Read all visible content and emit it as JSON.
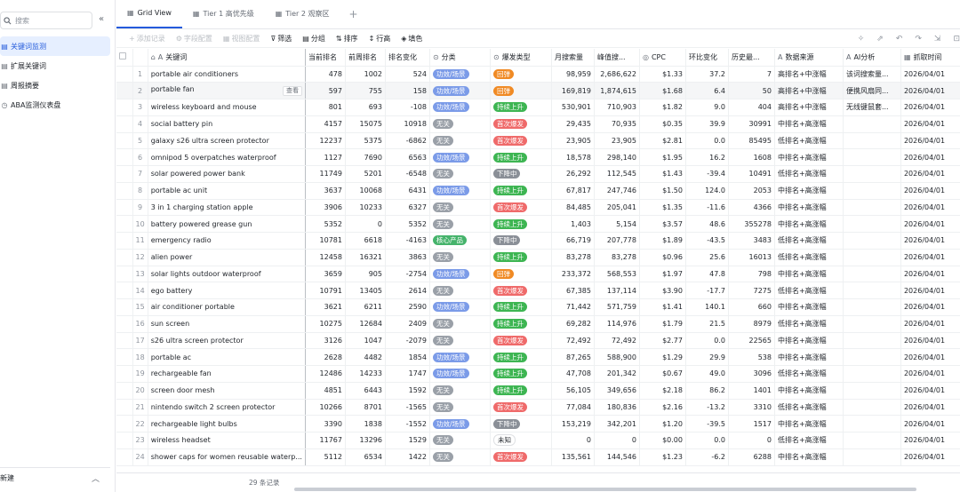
{
  "sidebar": {
    "search_placeholder": "搜索",
    "items": [
      {
        "label": "关键词监测",
        "active": true
      },
      {
        "label": "扩展关键词",
        "active": false
      },
      {
        "label": "周报摘要",
        "active": false
      },
      {
        "label": "ABA监测仪表盘",
        "active": false
      }
    ],
    "bottom_label": "新建"
  },
  "tabs": [
    {
      "label": "Grid View",
      "active": true
    },
    {
      "label": "Tier 1 高优先级",
      "active": false
    },
    {
      "label": "Tier 2 观察区",
      "active": false
    }
  ],
  "toolbar": {
    "add_record": "添加记录",
    "field_config": "字段配置",
    "view_config": "视图配置",
    "filter": "筛选",
    "group": "分组",
    "sort": "排序",
    "row_height": "行高",
    "fill": "填色"
  },
  "columns": [
    "关键词",
    "当前排名",
    "前周排名",
    "排名变化",
    "分类",
    "爆发类型",
    "月搜索量",
    "峰值搜...",
    "CPC",
    "环比变化",
    "历史最...",
    "数据来源",
    "AI分析",
    "抓取时间"
  ],
  "view_button": "查看",
  "record_count": "29 条记录",
  "tag_colors": {
    "功效/场景": "#7b9be8",
    "无关": "#9aa0a8",
    "核心产品": "#45b36b",
    "回弹": "#f08a24",
    "持续上升": "#3db552",
    "首次爆发": "#ef6a6a",
    "下降中": "#8a8f97",
    "未知": "#ffffff"
  },
  "rows": [
    {
      "idx": "1",
      "kw": "portable air conditioners",
      "cur": "478",
      "prev": "1002",
      "chg": "524",
      "cat": "功效/场景",
      "type": "回弹",
      "vol": "98,959",
      "peak": "2,686,622",
      "cpc": "$1.33",
      "mom": "37.2",
      "hist": "7",
      "src": "高排名+中涨幅",
      "ai": "该词搜索量...",
      "time": "2026/04/01"
    },
    {
      "idx": "2",
      "kw": "portable fan",
      "cur": "597",
      "prev": "755",
      "chg": "158",
      "cat": "功效/场景",
      "type": "回弹",
      "vol": "169,819",
      "peak": "1,874,615",
      "cpc": "$1.68",
      "mom": "6.4",
      "hist": "50",
      "src": "高排名+中涨幅",
      "ai": "便携风扇同...",
      "time": "2026/04/01"
    },
    {
      "idx": "3",
      "kw": "wireless keyboard and mouse",
      "cur": "801",
      "prev": "693",
      "chg": "-108",
      "cat": "功效/场景",
      "type": "持续上升",
      "vol": "530,901",
      "peak": "710,903",
      "cpc": "$1.82",
      "mom": "9.0",
      "hist": "404",
      "src": "高排名+中涨幅",
      "ai": "无线键鼠套...",
      "time": "2026/04/01"
    },
    {
      "idx": "4",
      "kw": "social battery pin",
      "cur": "4157",
      "prev": "15075",
      "chg": "10918",
      "cat": "无关",
      "type": "首次爆发",
      "vol": "29,435",
      "peak": "70,935",
      "cpc": "$0.35",
      "mom": "39.9",
      "hist": "30991",
      "src": "中排名+高涨幅",
      "ai": "",
      "time": "2026/04/01"
    },
    {
      "idx": "5",
      "kw": "galaxy s26 ultra screen protector",
      "cur": "12237",
      "prev": "5375",
      "chg": "-6862",
      "cat": "无关",
      "type": "首次爆发",
      "vol": "23,905",
      "peak": "23,905",
      "cpc": "$2.81",
      "mom": "0.0",
      "hist": "85495",
      "src": "低排名+高涨幅",
      "ai": "",
      "time": "2026/04/01"
    },
    {
      "idx": "6",
      "kw": "omnipod 5 overpatches waterproof",
      "cur": "1127",
      "prev": "7690",
      "chg": "6563",
      "cat": "功效/场景",
      "type": "持续上升",
      "vol": "18,578",
      "peak": "298,140",
      "cpc": "$1.95",
      "mom": "16.2",
      "hist": "1608",
      "src": "中排名+高涨幅",
      "ai": "",
      "time": "2026/04/01"
    },
    {
      "idx": "7",
      "kw": "solar powered power bank",
      "cur": "11749",
      "prev": "5201",
      "chg": "-6548",
      "cat": "无关",
      "type": "下降中",
      "vol": "26,292",
      "peak": "112,545",
      "cpc": "$1.43",
      "mom": "-39.4",
      "hist": "10491",
      "src": "低排名+高涨幅",
      "ai": "",
      "time": "2026/04/01"
    },
    {
      "idx": "8",
      "kw": "portable ac unit",
      "cur": "3637",
      "prev": "10068",
      "chg": "6431",
      "cat": "功效/场景",
      "type": "持续上升",
      "vol": "67,817",
      "peak": "247,746",
      "cpc": "$1.50",
      "mom": "124.0",
      "hist": "2053",
      "src": "中排名+高涨幅",
      "ai": "",
      "time": "2026/04/01"
    },
    {
      "idx": "9",
      "kw": "3 in 1 charging station apple",
      "cur": "3906",
      "prev": "10233",
      "chg": "6327",
      "cat": "无关",
      "type": "首次爆发",
      "vol": "84,485",
      "peak": "205,041",
      "cpc": "$1.35",
      "mom": "-11.6",
      "hist": "4366",
      "src": "中排名+高涨幅",
      "ai": "",
      "time": "2026/04/01"
    },
    {
      "idx": "10",
      "kw": "battery powered grease gun",
      "cur": "5352",
      "prev": "0",
      "chg": "5352",
      "cat": "无关",
      "type": "持续上升",
      "vol": "1,403",
      "peak": "5,154",
      "cpc": "$3.57",
      "mom": "48.6",
      "hist": "355278",
      "src": "中排名+高涨幅",
      "ai": "",
      "time": "2026/04/01"
    },
    {
      "idx": "11",
      "kw": "emergency radio",
      "cur": "10781",
      "prev": "6618",
      "chg": "-4163",
      "cat": "核心产品",
      "type": "下降中",
      "vol": "66,719",
      "peak": "207,778",
      "cpc": "$1.89",
      "mom": "-43.5",
      "hist": "3483",
      "src": "低排名+高涨幅",
      "ai": "",
      "time": "2026/04/01"
    },
    {
      "idx": "12",
      "kw": "alien power",
      "cur": "12458",
      "prev": "16321",
      "chg": "3863",
      "cat": "无关",
      "type": "持续上升",
      "vol": "83,278",
      "peak": "83,278",
      "cpc": "$0.96",
      "mom": "25.6",
      "hist": "16013",
      "src": "低排名+高涨幅",
      "ai": "",
      "time": "2026/04/01"
    },
    {
      "idx": "13",
      "kw": "solar lights outdoor waterproof",
      "cur": "3659",
      "prev": "905",
      "chg": "-2754",
      "cat": "功效/场景",
      "type": "回弹",
      "vol": "233,372",
      "peak": "568,553",
      "cpc": "$1.97",
      "mom": "47.8",
      "hist": "798",
      "src": "中排名+高涨幅",
      "ai": "",
      "time": "2026/04/01"
    },
    {
      "idx": "14",
      "kw": "ego battery",
      "cur": "10791",
      "prev": "13405",
      "chg": "2614",
      "cat": "无关",
      "type": "首次爆发",
      "vol": "67,385",
      "peak": "137,114",
      "cpc": "$3.90",
      "mom": "-17.7",
      "hist": "7275",
      "src": "低排名+高涨幅",
      "ai": "",
      "time": "2026/04/01"
    },
    {
      "idx": "15",
      "kw": "air conditioner portable",
      "cur": "3621",
      "prev": "6211",
      "chg": "2590",
      "cat": "功效/场景",
      "type": "持续上升",
      "vol": "71,442",
      "peak": "571,759",
      "cpc": "$1.41",
      "mom": "140.1",
      "hist": "660",
      "src": "中排名+高涨幅",
      "ai": "",
      "time": "2026/04/01"
    },
    {
      "idx": "16",
      "kw": "sun screen",
      "cur": "10275",
      "prev": "12684",
      "chg": "2409",
      "cat": "无关",
      "type": "持续上升",
      "vol": "69,282",
      "peak": "114,976",
      "cpc": "$1.79",
      "mom": "21.5",
      "hist": "8979",
      "src": "低排名+高涨幅",
      "ai": "",
      "time": "2026/04/01"
    },
    {
      "idx": "17",
      "kw": "s26 ultra screen protector",
      "cur": "3126",
      "prev": "1047",
      "chg": "-2079",
      "cat": "无关",
      "type": "首次爆发",
      "vol": "72,492",
      "peak": "72,492",
      "cpc": "$2.77",
      "mom": "0.0",
      "hist": "22565",
      "src": "中排名+高涨幅",
      "ai": "",
      "time": "2026/04/01"
    },
    {
      "idx": "18",
      "kw": "portable ac",
      "cur": "2628",
      "prev": "4482",
      "chg": "1854",
      "cat": "功效/场景",
      "type": "持续上升",
      "vol": "87,265",
      "peak": "588,900",
      "cpc": "$1.29",
      "mom": "29.9",
      "hist": "538",
      "src": "中排名+高涨幅",
      "ai": "",
      "time": "2026/04/01"
    },
    {
      "idx": "19",
      "kw": "rechargeable fan",
      "cur": "12486",
      "prev": "14233",
      "chg": "1747",
      "cat": "功效/场景",
      "type": "持续上升",
      "vol": "47,708",
      "peak": "201,342",
      "cpc": "$0.67",
      "mom": "49.0",
      "hist": "3096",
      "src": "低排名+高涨幅",
      "ai": "",
      "time": "2026/04/01"
    },
    {
      "idx": "20",
      "kw": "screen door mesh",
      "cur": "4851",
      "prev": "6443",
      "chg": "1592",
      "cat": "无关",
      "type": "持续上升",
      "vol": "56,105",
      "peak": "349,656",
      "cpc": "$2.18",
      "mom": "86.2",
      "hist": "1401",
      "src": "中排名+高涨幅",
      "ai": "",
      "time": "2026/04/01"
    },
    {
      "idx": "21",
      "kw": "nintendo switch 2 screen protector",
      "cur": "10266",
      "prev": "8701",
      "chg": "-1565",
      "cat": "无关",
      "type": "首次爆发",
      "vol": "77,084",
      "peak": "180,836",
      "cpc": "$2.16",
      "mom": "-13.2",
      "hist": "3310",
      "src": "低排名+高涨幅",
      "ai": "",
      "time": "2026/04/01"
    },
    {
      "idx": "22",
      "kw": "rechargeable light bulbs",
      "cur": "3390",
      "prev": "1838",
      "chg": "-1552",
      "cat": "功效/场景",
      "type": "下降中",
      "vol": "153,219",
      "peak": "342,201",
      "cpc": "$1.20",
      "mom": "-39.5",
      "hist": "1517",
      "src": "中排名+高涨幅",
      "ai": "",
      "time": "2026/04/01"
    },
    {
      "idx": "23",
      "kw": "wireless headset",
      "cur": "11767",
      "prev": "13296",
      "chg": "1529",
      "cat": "无关",
      "type": "未知",
      "vol": "0",
      "peak": "0",
      "cpc": "$0.00",
      "mom": "0.0",
      "hist": "0",
      "src": "低排名+高涨幅",
      "ai": "",
      "time": "2026/04/01"
    },
    {
      "idx": "24",
      "kw": "shower caps for women reusable waterp...",
      "cur": "5112",
      "prev": "6534",
      "chg": "1422",
      "cat": "无关",
      "type": "首次爆发",
      "vol": "135,561",
      "peak": "144,546",
      "cpc": "$1.23",
      "mom": "-6.2",
      "hist": "6288",
      "src": "中排名+高涨幅",
      "ai": "",
      "time": "2026/04/01"
    }
  ]
}
